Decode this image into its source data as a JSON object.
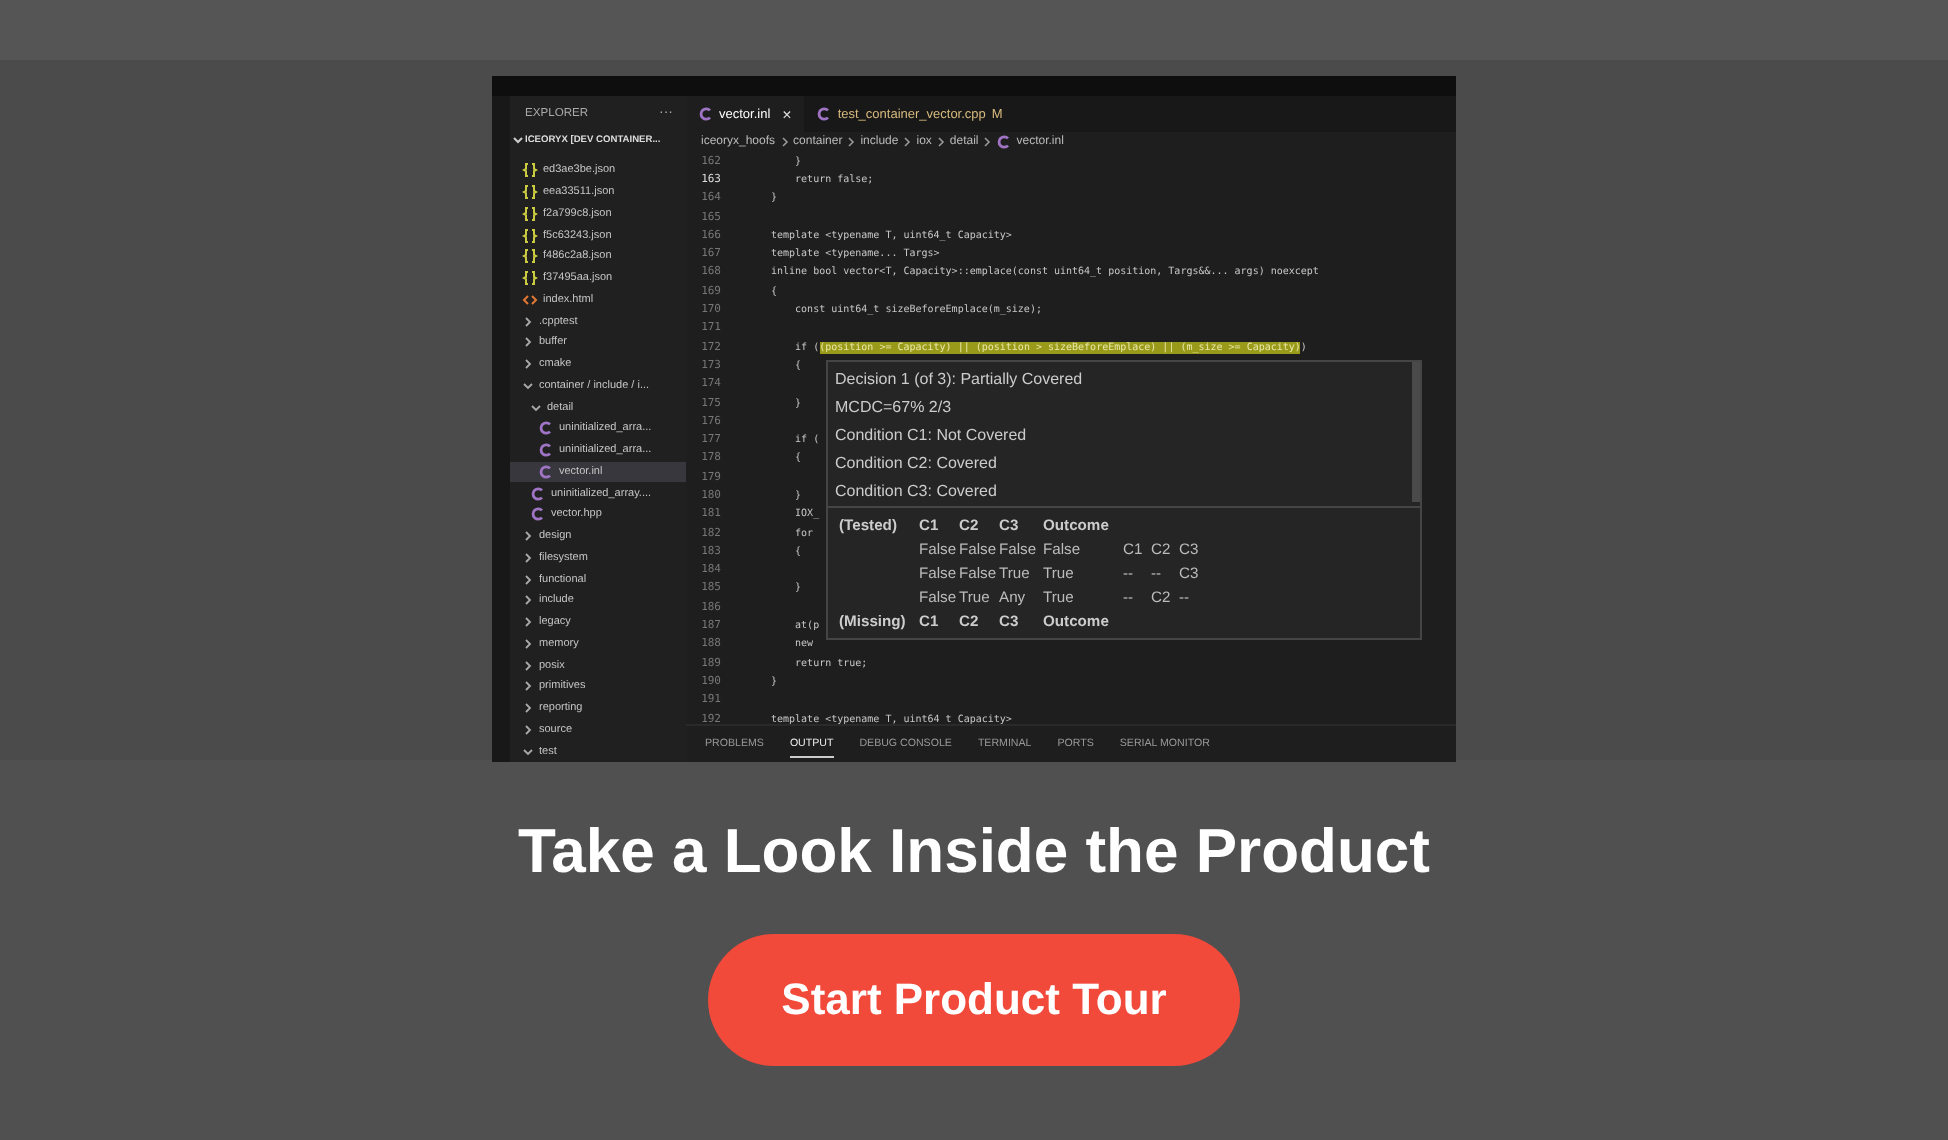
{
  "explorer": {
    "title": "EXPLORER",
    "more": "···",
    "root": "ICEORYX [DEV CONTAINER...",
    "items": [
      {
        "kind": "json",
        "label": "ed3ae3be.json",
        "selected": false
      },
      {
        "kind": "json",
        "label": "eea33511.json",
        "selected": false
      },
      {
        "kind": "json",
        "label": "f2a799c8.json",
        "selected": false
      },
      {
        "kind": "json",
        "label": "f5c63243.json",
        "selected": false
      },
      {
        "kind": "json",
        "label": "f486c2a8.json",
        "selected": false
      },
      {
        "kind": "json",
        "label": "f37495aa.json",
        "selected": false
      },
      {
        "kind": "html",
        "label": "index.html",
        "selected": false
      },
      {
        "kind": "folder",
        "label": ".cpptest",
        "selected": false,
        "expanded": false
      },
      {
        "kind": "folder",
        "label": "buffer",
        "selected": false,
        "expanded": false
      },
      {
        "kind": "folder",
        "label": "cmake",
        "selected": false,
        "expanded": false
      },
      {
        "kind": "folder",
        "label": "container / include / i...",
        "selected": false,
        "expanded": true,
        "children": [
          {
            "kind": "folder",
            "label": "detail",
            "selected": false,
            "expanded": true,
            "children": [
              {
                "kind": "cpp",
                "label": "uninitialized_arra...",
                "selected": false
              },
              {
                "kind": "cpp",
                "label": "uninitialized_arra...",
                "selected": false
              },
              {
                "kind": "cpp",
                "label": "vector.inl",
                "selected": true
              }
            ]
          },
          {
            "kind": "cpp",
            "label": "uninitialized_array....",
            "selected": false
          },
          {
            "kind": "cpp",
            "label": "vector.hpp",
            "selected": false
          }
        ]
      },
      {
        "kind": "folder",
        "label": "design",
        "selected": false,
        "expanded": false
      },
      {
        "kind": "folder",
        "label": "filesystem",
        "selected": false,
        "expanded": false
      },
      {
        "kind": "folder",
        "label": "functional",
        "selected": false,
        "expanded": false
      },
      {
        "kind": "folder",
        "label": "include",
        "selected": false,
        "expanded": false
      },
      {
        "kind": "folder",
        "label": "legacy",
        "selected": false,
        "expanded": false
      },
      {
        "kind": "folder",
        "label": "memory",
        "selected": false,
        "expanded": false
      },
      {
        "kind": "folder",
        "label": "posix",
        "selected": false,
        "expanded": false
      },
      {
        "kind": "folder",
        "label": "primitives",
        "selected": false,
        "expanded": false
      },
      {
        "kind": "folder",
        "label": "reporting",
        "selected": false,
        "expanded": false
      },
      {
        "kind": "folder",
        "label": "source",
        "selected": false,
        "expanded": false
      },
      {
        "kind": "folder",
        "label": "test",
        "selected": false,
        "expanded": true
      }
    ]
  },
  "tabs": [
    {
      "label": "vector.inl",
      "selected": true,
      "close": "×"
    },
    {
      "label": "test_container_vector.cpp",
      "selected": false,
      "badge": "M"
    }
  ],
  "breadcrumb": [
    "iceoryx_hoofs",
    "container",
    "include",
    "iox",
    "detail",
    "vector.inl"
  ],
  "lines": [
    {
      "number": "162",
      "current": false,
      "code": "    }"
    },
    {
      "number": "163",
      "current": true,
      "code": "    return false;"
    },
    {
      "number": "164",
      "current": false,
      "code": "}"
    },
    {
      "number": "165",
      "current": false
    },
    {
      "number": "166",
      "current": false,
      "code": "template <typename T, uint64_t Capacity>"
    },
    {
      "number": "167",
      "current": false,
      "code": "template <typename... Targs>"
    },
    {
      "number": "168",
      "current": false,
      "code": "inline bool vector<T, Capacity>::emplace(const uint64_t position, Targs&&... args) noexcept"
    },
    {
      "number": "169",
      "current": false,
      "code": "{"
    },
    {
      "number": "170",
      "current": false,
      "code": "    const uint64_t sizeBeforeEmplace(m_size);"
    },
    {
      "number": "171",
      "current": false
    },
    {
      "number": "172",
      "current": false,
      "code": "    if (",
      "highlight": "(position >= Capacity) || (position > sizeBeforeEmplace) || (m_size >= Capacity)",
      "after": ")"
    },
    {
      "number": "173",
      "current": false,
      "code": "    {"
    },
    {
      "number": "174",
      "current": false
    },
    {
      "number": "175",
      "current": false,
      "code": "    }"
    },
    {
      "number": "176",
      "current": false
    },
    {
      "number": "177",
      "current": false,
      "code": "    if ("
    },
    {
      "number": "178",
      "current": false,
      "code": "    {"
    },
    {
      "number": "179",
      "current": false
    },
    {
      "number": "180",
      "current": false,
      "code": "    }"
    },
    {
      "number": "181",
      "current": false,
      "code": "    IOX_"
    },
    {
      "number": "182",
      "current": false,
      "code": "    for"
    },
    {
      "number": "183",
      "current": false,
      "code": "    {"
    },
    {
      "number": "184",
      "current": false
    },
    {
      "number": "185",
      "current": false,
      "code": "    }"
    },
    {
      "number": "186",
      "current": false
    },
    {
      "number": "187",
      "current": false,
      "code": "    at(p"
    },
    {
      "number": "188",
      "current": false,
      "code": "    new"
    },
    {
      "number": "189",
      "current": false,
      "code": "    return true;"
    },
    {
      "number": "190",
      "current": false,
      "code": "}"
    },
    {
      "number": "191",
      "current": false
    },
    {
      "number": "192",
      "current": false,
      "code": "template <typename T, uint64_t Capacity>"
    }
  ],
  "hover": {
    "lines": [
      "Decision 1 (of 3): Partially Covered",
      "MCDC=67% 2/3",
      "Condition C1: Not Covered",
      "Condition C2: Covered",
      "Condition C3: Covered"
    ],
    "tested_header": [
      "(Tested)",
      "C1",
      "C2",
      "C3",
      "Outcome"
    ],
    "tested_rows": [
      [
        "False",
        "False",
        "False",
        "False",
        "C1",
        "C2",
        "C3"
      ],
      [
        "False",
        "False",
        "True",
        "True",
        "--",
        "--",
        "C3"
      ],
      [
        "False",
        "True",
        "Any",
        "True",
        "--",
        "C2",
        "--"
      ]
    ],
    "missing_header": [
      "(Missing)",
      "C1",
      "C2",
      "C3",
      "Outcome"
    ]
  },
  "panel_tabs": [
    {
      "label": "PROBLEMS",
      "selected": false
    },
    {
      "label": "OUTPUT",
      "selected": true
    },
    {
      "label": "DEBUG CONSOLE",
      "selected": false
    },
    {
      "label": "TERMINAL",
      "selected": false
    },
    {
      "label": "PORTS",
      "selected": false
    },
    {
      "label": "SERIAL MONITOR",
      "selected": false
    }
  ],
  "heading": "Take a Look Inside the Product",
  "cta": "Start Product Tour"
}
